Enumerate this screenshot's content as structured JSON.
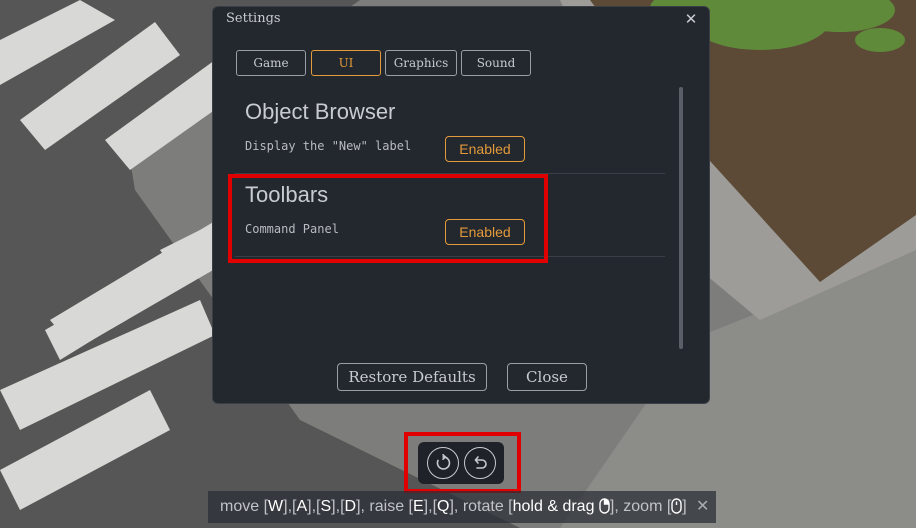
{
  "dialog": {
    "title": "Settings",
    "close_glyph": "✕",
    "tabs": [
      {
        "label": "Game",
        "active": false
      },
      {
        "label": "UI",
        "active": true
      },
      {
        "label": "Graphics",
        "active": false
      },
      {
        "label": "Sound",
        "active": false
      }
    ],
    "sections": [
      {
        "title": "Object Browser",
        "setting": {
          "label": "Display the \"New\" label",
          "value": "Enabled"
        }
      },
      {
        "title": "Toolbars",
        "setting": {
          "label": "Command Panel",
          "value": "Enabled"
        }
      }
    ],
    "buttons": {
      "restore": "Restore Defaults",
      "close": "Close"
    }
  },
  "history_toolbar": {
    "buttons": [
      {
        "icon": "redo-icon"
      },
      {
        "icon": "undo-icon"
      }
    ]
  },
  "hint_bar": {
    "parts": {
      "move_prefix": "move ",
      "key_w": "W",
      "key_a": "A",
      "key_s": "S",
      "key_d": "D",
      "raise_prefix": ", raise ",
      "key_e": "E",
      "key_q": "Q",
      "rotate_prefix": ", rotate ",
      "rotate_action": "hold & drag",
      "zoom_prefix": ", zoom "
    },
    "close_glyph": "✕"
  },
  "colors": {
    "accent": "#e39a3a",
    "dialog_bg": "#23272e",
    "highlight": "#e00000"
  }
}
